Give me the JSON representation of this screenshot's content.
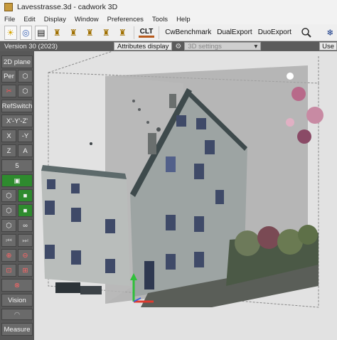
{
  "window": {
    "title": "Lavesstrasse.3d - cadwork 3D"
  },
  "menu": [
    "File",
    "Edit",
    "Display",
    "Window",
    "Preferences",
    "Tools",
    "Help"
  ],
  "toolbar": {
    "clt": "CLT",
    "cwbenchmark": "CwBenchmark",
    "dualexport": "DualExport",
    "duoexport": "DuoExport"
  },
  "status": {
    "version": "Version 30 (2023)",
    "attributes_display": "Attributes display",
    "settings_3d": "3D settings",
    "use": "Use"
  },
  "left_panel": {
    "plane_2d": "2D plane",
    "per": "Per",
    "refswitch": "RefSwitch",
    "xyz": "X'-Y'-Z'",
    "x": "X",
    "neg_y": "-Y",
    "z": "Z",
    "a": "A",
    "five": "5",
    "vision": "Vision",
    "measure": "Measure"
  },
  "colors": {
    "panel": "#575757",
    "button": "#6a6a6a",
    "green": "#2e8b2e",
    "viewport": "#dcdcdc"
  }
}
